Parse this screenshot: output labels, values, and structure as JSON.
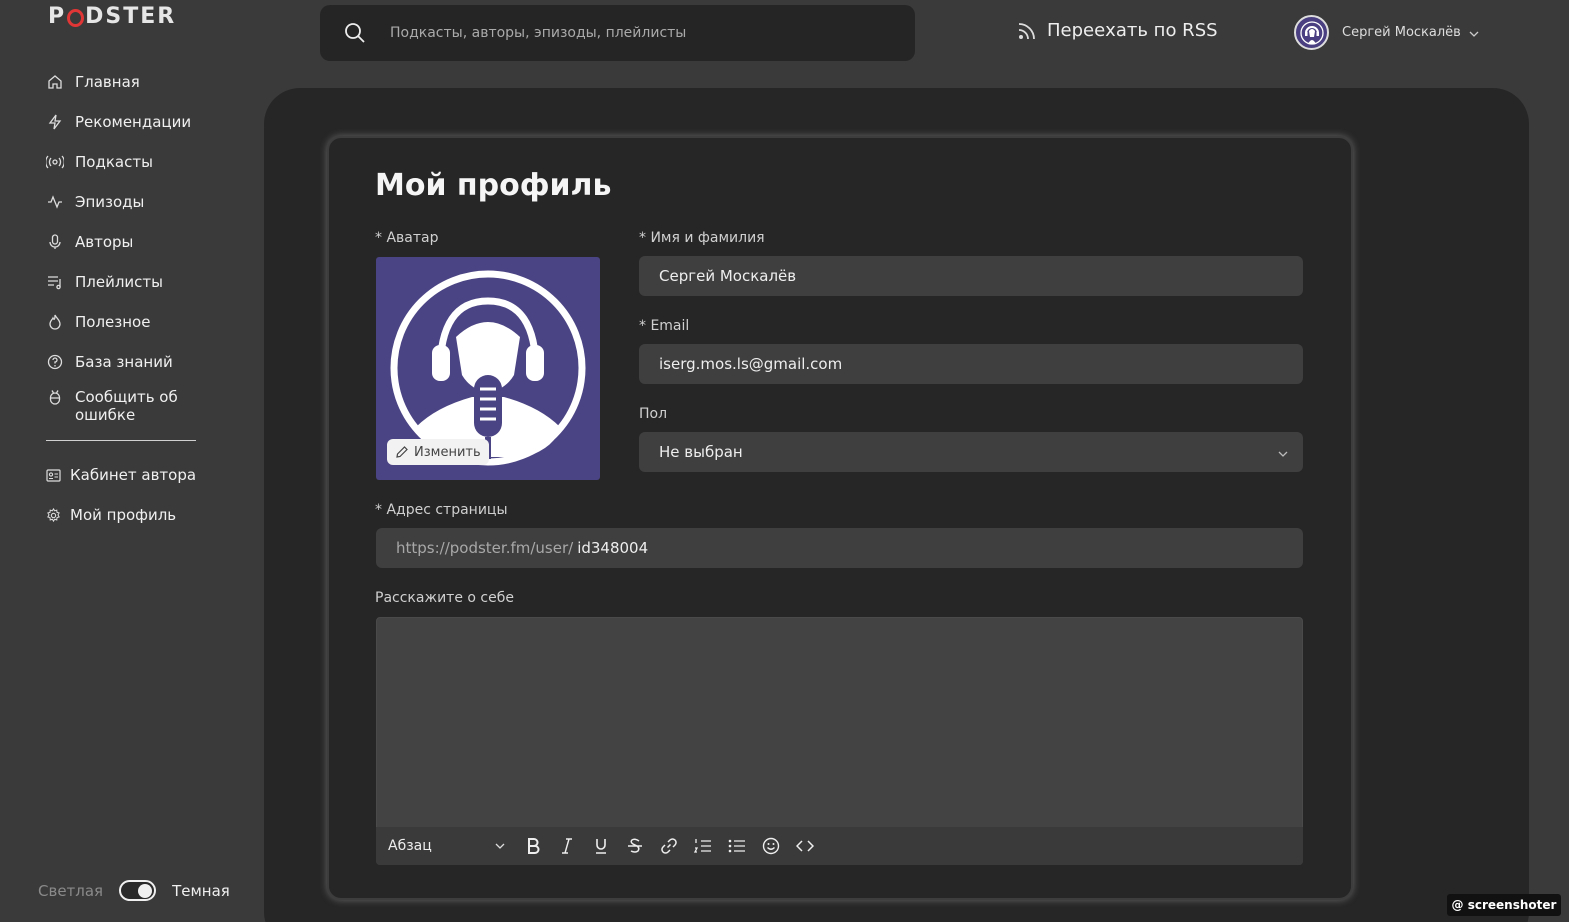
{
  "app": {
    "logo_text_pre": "P",
    "logo_text_post": "DSTER",
    "brand_color": "#e13636"
  },
  "sidebar": {
    "items": [
      {
        "label": "Главная",
        "icon": "home-icon"
      },
      {
        "label": "Рекомендации",
        "icon": "lightning-icon"
      },
      {
        "label": "Подкасты",
        "icon": "broadcast-icon"
      },
      {
        "label": "Эпизоды",
        "icon": "pulse-icon"
      },
      {
        "label": "Авторы",
        "icon": "microphone-icon"
      },
      {
        "label": "Плейлисты",
        "icon": "playlist-icon"
      },
      {
        "label": "Полезное",
        "icon": "flame-icon"
      },
      {
        "label": "База знаний",
        "icon": "help-icon"
      },
      {
        "label": "Сообщить об ошибке",
        "icon": "bug-icon"
      }
    ],
    "secondary": [
      {
        "label": "Кабинет автора",
        "icon": "id-card-icon"
      },
      {
        "label": "Мой профиль",
        "icon": "gear-icon"
      }
    ]
  },
  "theme": {
    "light_label": "Светлая",
    "dark_label": "Темная",
    "is_dark": true
  },
  "header": {
    "search_placeholder": "Подкасты, авторы, эпизоды, плейлисты",
    "rss_label": "Переехать по RSS",
    "user_name": "Сергей Москалёв"
  },
  "profile": {
    "title": "Мой профиль",
    "avatar_label": "* Аватар",
    "change_label": "Изменить",
    "name_label": "* Имя и фамилия",
    "name_value": "Сергей Москалёв",
    "email_label": "* Email",
    "email_value": "iserg.mos.ls@gmail.com",
    "gender_label": "Пол",
    "gender_value": "Не выбран",
    "address_label": "* Адрес страницы",
    "address_prefix": "https://podster.fm/user/",
    "address_value": "id348004",
    "about_label": "Расскажите о себе",
    "about_value": ""
  },
  "editor_toolbar": {
    "paragraph_label": "Абзац",
    "buttons": [
      "bold-icon",
      "italic-icon",
      "underline-icon",
      "strikethrough-icon",
      "link-icon",
      "ordered-list-icon",
      "bullet-list-icon",
      "emoji-icon",
      "code-icon"
    ]
  },
  "watermark": "@ screenshoter"
}
